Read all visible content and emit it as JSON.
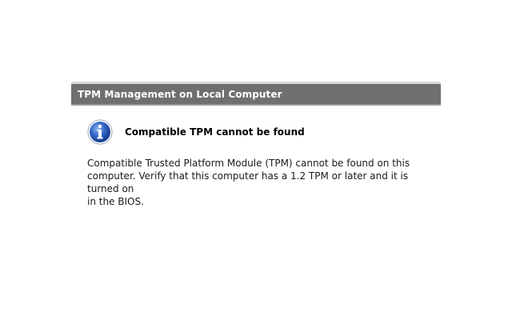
{
  "header": {
    "title": "TPM Management on Local Computer"
  },
  "message": {
    "icon": "info-icon",
    "heading": "Compatible TPM cannot be found",
    "body_lines": [
      "Compatible Trusted Platform Module (TPM) cannot be found on this",
      "computer. Verify that this computer has a 1.2 TPM or later and it is turned on",
      "in the BIOS."
    ]
  },
  "colors": {
    "header_background": "#6f6f6f",
    "icon_blue": "#2a5bb8"
  }
}
